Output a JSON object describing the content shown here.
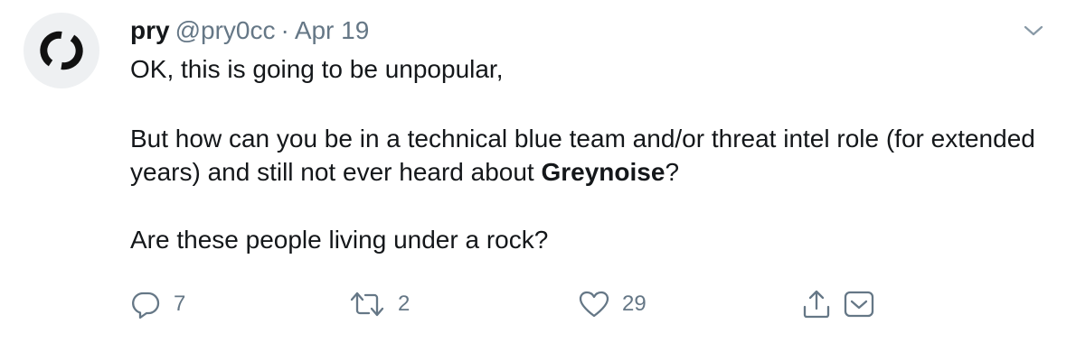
{
  "tweet": {
    "display_name": "pry",
    "handle": "@pry0cc",
    "separator": "·",
    "date": "Apr 19",
    "text": {
      "line1": "OK, this is going to be unpopular,",
      "para2_before": "But how can you be in a technical blue team and/or threat intel role (for extended years) and still not ever heard about ",
      "para2_bold": "Greynoise",
      "para2_after": "?",
      "para3": "Are these people living under a rock?"
    },
    "actions": {
      "reply_count": "7",
      "retweet_count": "2",
      "like_count": "29"
    }
  },
  "icons": {
    "reply": "reply-icon",
    "retweet": "retweet-icon",
    "like": "heart-icon",
    "share": "share-icon",
    "dm": "direct-message-icon",
    "menu": "chevron-down-icon",
    "avatar": "avatar-logo-icon"
  },
  "colors": {
    "text": "#14171a",
    "secondary": "#657786",
    "avatar_bg": "#eef0f2"
  }
}
